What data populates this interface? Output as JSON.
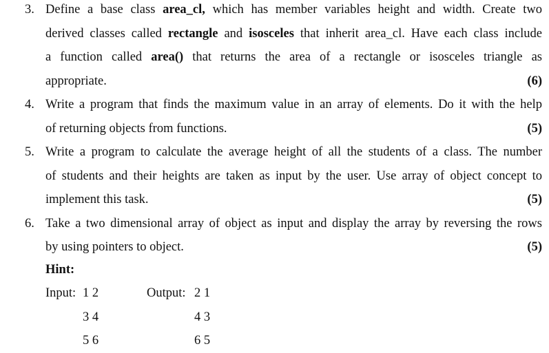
{
  "questions": [
    {
      "number": "3.",
      "marks": "(6)",
      "lines": [
        [
          {
            "t": "Define a base class "
          },
          {
            "t": "area_cl,",
            "b": true
          },
          {
            "t": " which has member variables height and width. Create two"
          }
        ],
        [
          {
            "t": "derived classes called "
          },
          {
            "t": "rectangle",
            "b": true
          },
          {
            "t": " and "
          },
          {
            "t": "isosceles",
            "b": true
          },
          {
            "t": " that inherit area_cl. Have each class include"
          }
        ],
        [
          {
            "t": "a function called "
          },
          {
            "t": "area()",
            "b": true
          },
          {
            "t": " that returns the area of a rectangle or isosceles triangle as"
          }
        ],
        [
          {
            "t": "appropriate."
          }
        ]
      ]
    },
    {
      "number": "4.",
      "marks": "(5)",
      "lines": [
        [
          {
            "t": "Write a program that finds the maximum value in an array of elements. Do it with the help"
          }
        ],
        [
          {
            "t": "of returning objects from functions."
          }
        ]
      ]
    },
    {
      "number": "5.",
      "marks": "(5)",
      "lines": [
        [
          {
            "t": "Write a program to calculate the average height of all the students of a class. The number"
          }
        ],
        [
          {
            "t": "of students and their heights are taken as input by the user. Use array of object concept to"
          }
        ],
        [
          {
            "t": "implement this task."
          }
        ]
      ]
    },
    {
      "number": "6.",
      "marks": "(5)",
      "lines": [
        [
          {
            "t": "Take a two dimensional array of object as input and display the array by reversing the rows"
          }
        ],
        [
          {
            "t": "by using pointers to object."
          }
        ]
      ]
    }
  ],
  "hint": {
    "title": "Hint:",
    "input_label": "Input:",
    "output_label": "Output:",
    "input_rows": [
      "1 2",
      "3 4",
      "5 6"
    ],
    "output_rows": [
      "2 1",
      "4 3",
      "6 5"
    ]
  }
}
